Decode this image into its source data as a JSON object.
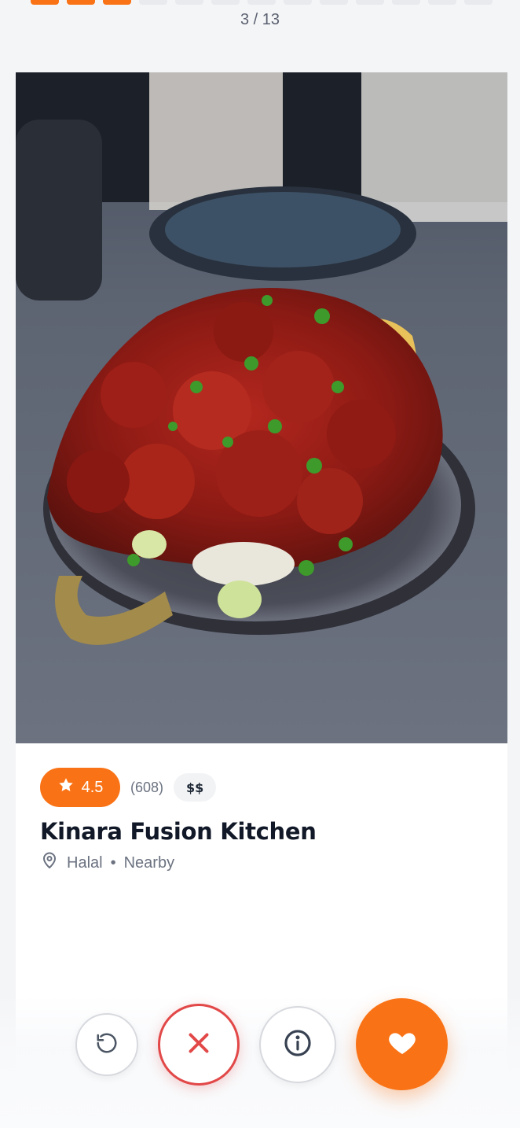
{
  "progress": {
    "current": 3,
    "total": 13,
    "counter_text": "3 / 13"
  },
  "restaurant": {
    "rating": "4.5",
    "review_count": "(608)",
    "price_level": "$$",
    "name": "Kinara Fusion Kitchen",
    "tags": "Halal",
    "separator": "•",
    "distance": "Nearby"
  },
  "icons": {
    "rating": "star-icon",
    "location": "map-pin-icon",
    "undo": "undo-icon",
    "dislike": "close-icon",
    "info": "info-icon",
    "like": "heart-icon"
  },
  "colors": {
    "accent": "#f97316",
    "dislike": "#e24848",
    "text": "#111827",
    "muted": "#6b7280"
  }
}
